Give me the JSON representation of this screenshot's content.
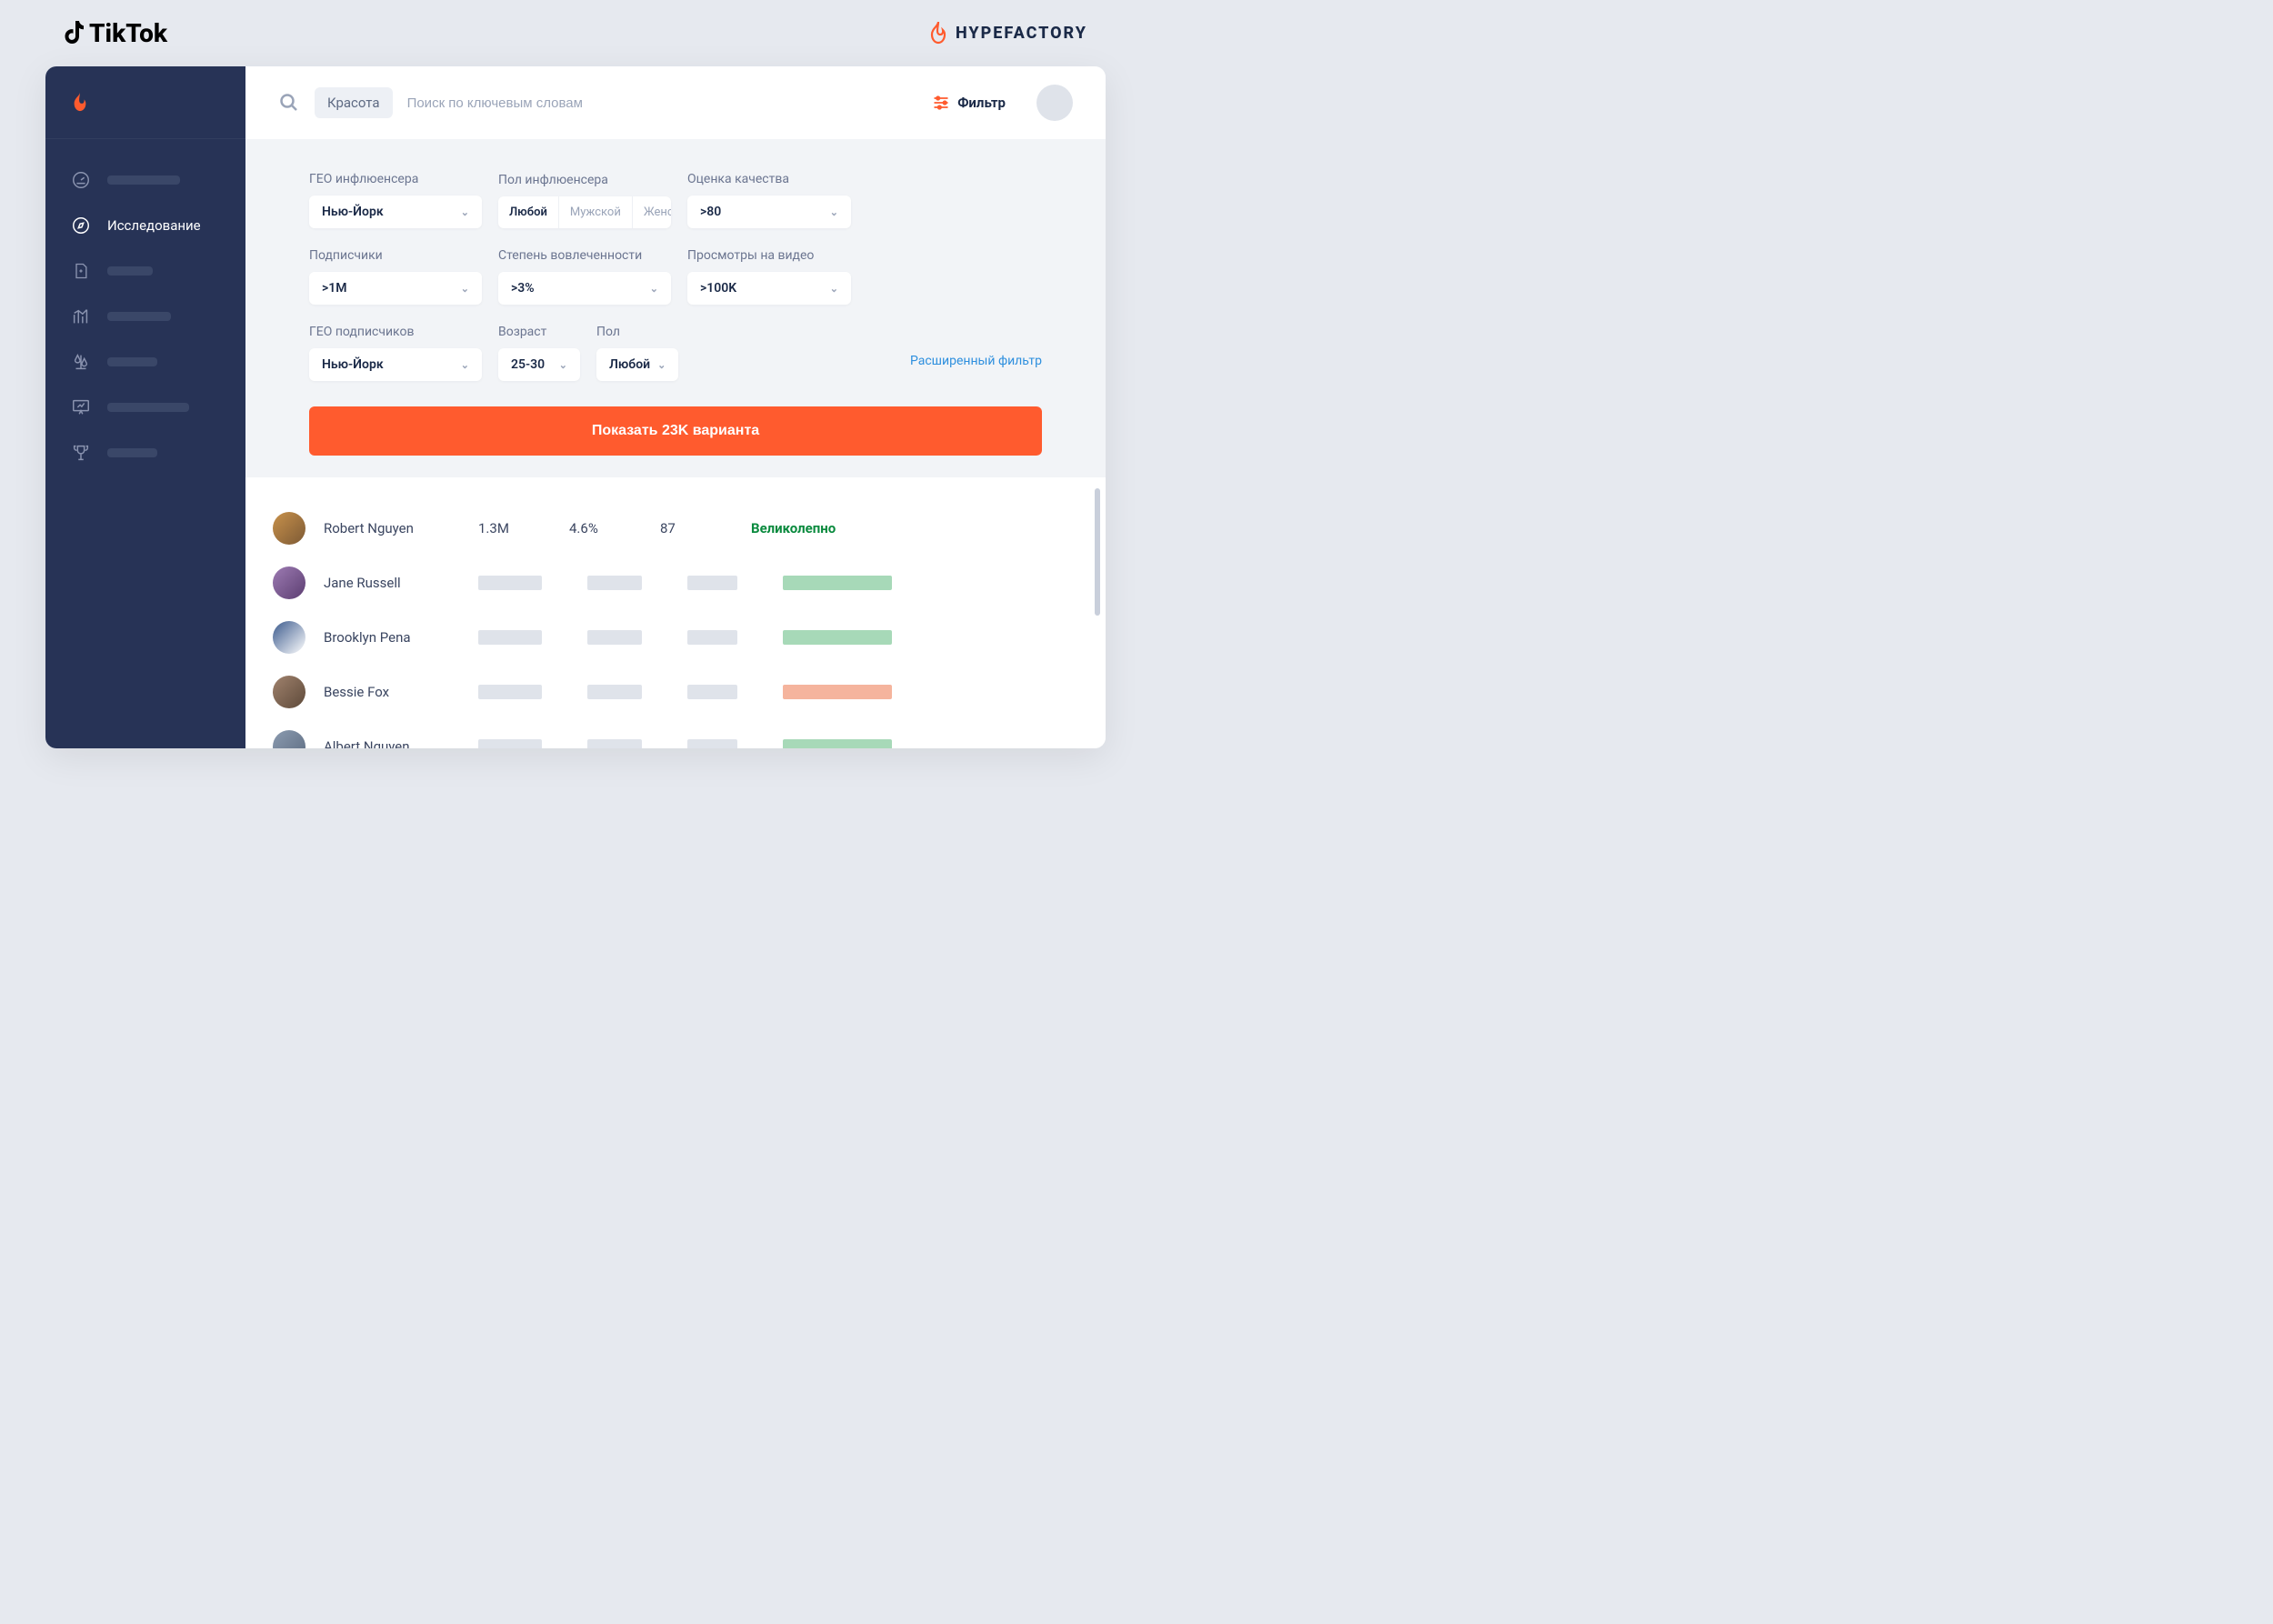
{
  "brands": {
    "tiktok": "TikTok",
    "hypefactory": "HYPEFACTORY"
  },
  "sidebar": {
    "active_label": "Исследование"
  },
  "header": {
    "search_tag": "Красота",
    "search_placeholder": "Поиск по ключевым словам",
    "filter_label": "Фильтр"
  },
  "filters": {
    "row1": {
      "geo_influencer": {
        "label": "ГЕО инфлюенсера",
        "value": "Нью-Йорк"
      },
      "gender_influencer": {
        "label": "Пол инфлюенсера",
        "options": [
          "Любой",
          "Мужской",
          "Женский"
        ],
        "selected": "Любой"
      },
      "quality": {
        "label": "Оценка качества",
        "value": ">80"
      }
    },
    "row2": {
      "followers": {
        "label": "Подписчики",
        "value": ">1M"
      },
      "engagement": {
        "label": "Степень вовлеченности",
        "value": ">3%"
      },
      "views": {
        "label": "Просмотры на видео",
        "value": ">100K"
      }
    },
    "row3": {
      "geo_followers": {
        "label": "ГЕО подписчиков",
        "value": "Нью-Йорк"
      },
      "age": {
        "label": "Возраст",
        "value": "25-30"
      },
      "gender": {
        "label": "Пол",
        "value": "Любой"
      },
      "advanced_link": "Расширенный фильтр"
    },
    "submit": "Показать 23K варианта"
  },
  "results": [
    {
      "name": "Robert Nguyen",
      "followers": "1.3M",
      "engagement": "4.6%",
      "score": "87",
      "rating": "Великолепно",
      "rating_color": "green"
    },
    {
      "name": "Jane Russell",
      "rating_color": "green"
    },
    {
      "name": "Brooklyn Pena",
      "rating_color": "green"
    },
    {
      "name": "Bessie Fox",
      "rating_color": "orange"
    },
    {
      "name": "Albert Nguyen",
      "rating_color": "green"
    }
  ]
}
